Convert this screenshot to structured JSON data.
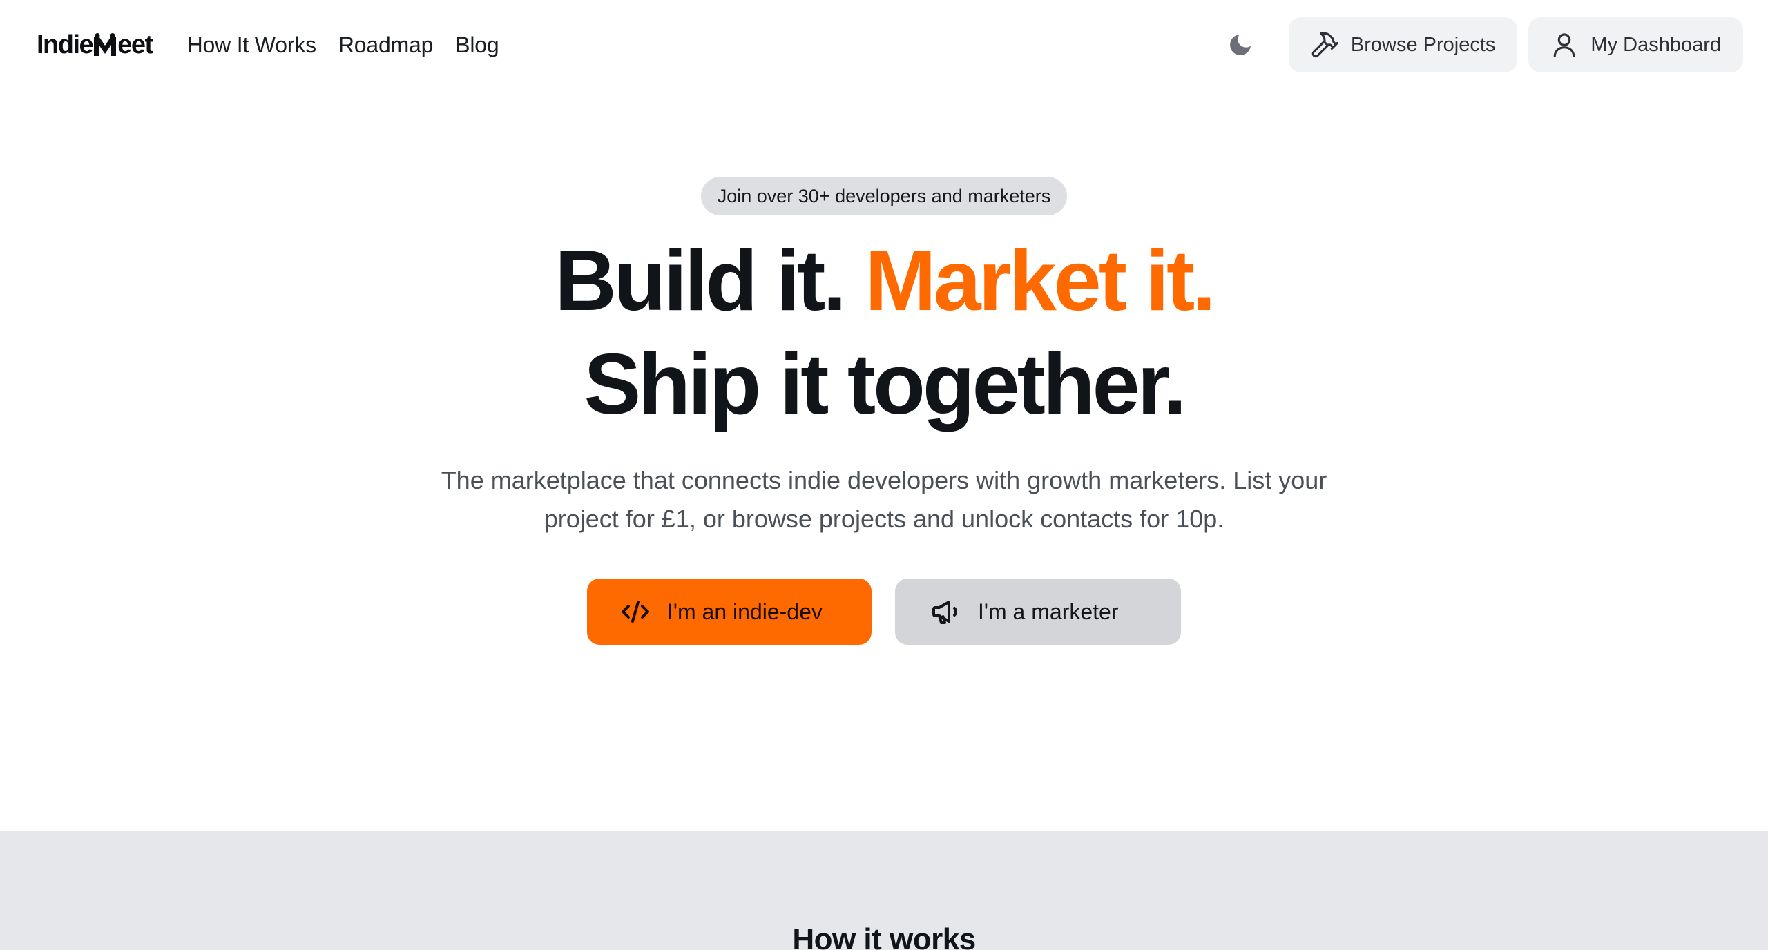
{
  "nav": {
    "logo": {
      "part1": "Indie",
      "part2": "eet"
    },
    "links": [
      "How It Works",
      "Roadmap",
      "Blog"
    ],
    "theme_icon": "moon-icon",
    "browse_label": "Browse Projects",
    "browse_icon": "hammer-icon",
    "dashboard_label": "My Dashboard",
    "dashboard_icon": "user-icon"
  },
  "hero": {
    "pill": "Join over 30+ developers and marketers",
    "headline_part1": "Build it. ",
    "headline_accent": "Market it.",
    "headline_line2": "Ship it together.",
    "subtext": "The marketplace that connects indie developers with growth marketers. List your project for £1, or browse projects and unlock contacts for 10p.",
    "cta_dev_label": "I'm an indie-dev",
    "cta_dev_icon": "code-icon",
    "cta_marketer_label": "I'm a marketer",
    "cta_marketer_icon": "megaphone-icon"
  },
  "how_it_works": {
    "title": "How it works"
  },
  "colors": {
    "accent": "#ff6a00",
    "pill_bg": "#dedfe2",
    "section_bg": "#e5e7eb"
  }
}
